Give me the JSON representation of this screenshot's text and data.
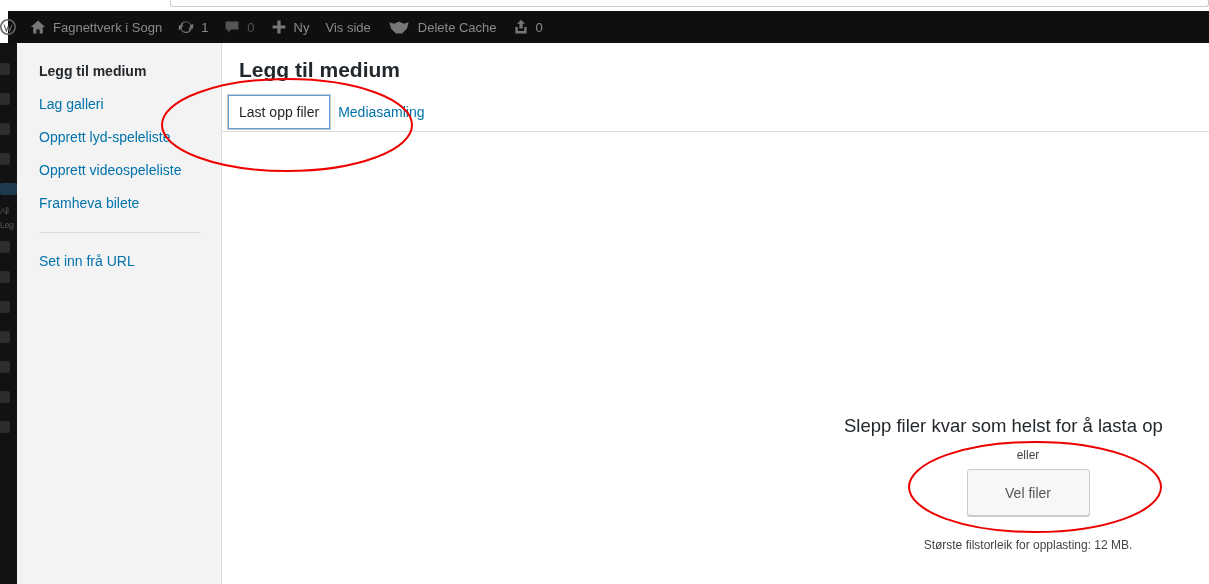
{
  "admin_bar": {
    "site": "Fagnettverk i Sogn",
    "updates": "1",
    "comments": "0",
    "new": "Ny",
    "view": "Vis side",
    "cache": "Delete Cache",
    "uploads": "0"
  },
  "admin_menu": {
    "items": [
      "All",
      "Leg"
    ]
  },
  "sidebar": {
    "title": "Legg til medium",
    "sections": [
      {
        "items": [
          "Lag galleri",
          "Opprett lyd-speleliste",
          "Opprett videospeleliste",
          "Framheva bilete"
        ]
      },
      {
        "items": [
          "Set inn frå URL"
        ]
      }
    ]
  },
  "modal": {
    "title": "Legg til medium",
    "tabs": [
      {
        "label": "Last opp filer",
        "selected": true
      },
      {
        "label": "Mediasamling",
        "selected": false
      }
    ]
  },
  "uploader": {
    "instructions": "Slepp filer kvar som helst for å lasta op",
    "or": "eller",
    "button": "Vel filer",
    "max_size": "Største filstorleik for opplasting: 12 MB."
  }
}
